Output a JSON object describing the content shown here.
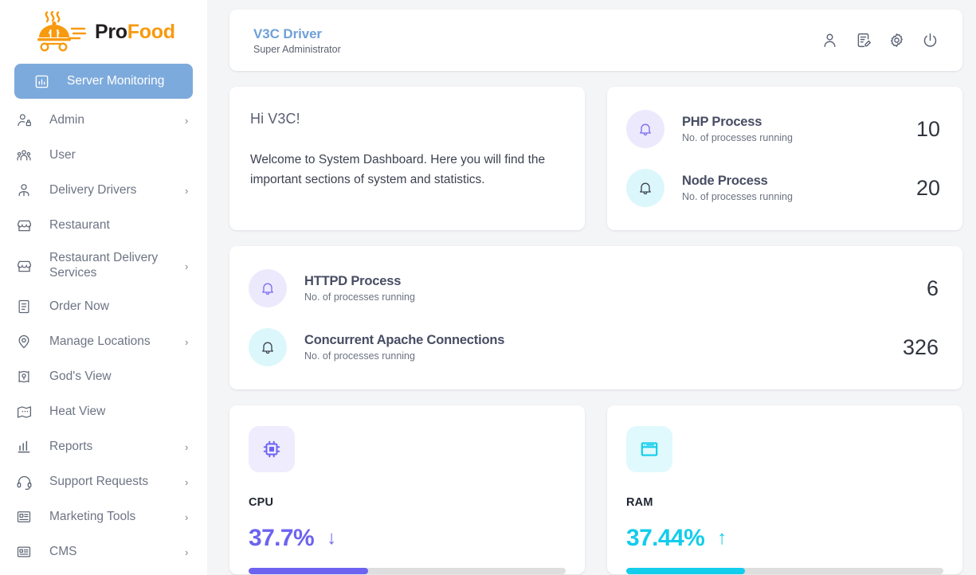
{
  "brand": {
    "name_pro": "Pro",
    "name_food": "Food",
    "logo_icon": "food-cart-cloche-icon"
  },
  "sidebar": {
    "items": [
      {
        "label": "Server Monitoring",
        "icon": "chart-bar-icon",
        "active": true,
        "chevron": false
      },
      {
        "label": "Admin",
        "icon": "user-lock-icon",
        "active": false,
        "chevron": true
      },
      {
        "label": "User",
        "icon": "users-group-icon",
        "active": false,
        "chevron": false
      },
      {
        "label": "Delivery Drivers",
        "icon": "user-tie-icon",
        "active": false,
        "chevron": true
      },
      {
        "label": "Restaurant",
        "icon": "storefront-icon",
        "active": false,
        "chevron": false
      },
      {
        "label": "Restaurant Delivery Services",
        "icon": "storefront-icon",
        "active": false,
        "chevron": true
      },
      {
        "label": "Order Now",
        "icon": "list-document-icon",
        "active": false,
        "chevron": false
      },
      {
        "label": "Manage Locations",
        "icon": "map-pin-icon",
        "active": false,
        "chevron": true
      },
      {
        "label": "God's View",
        "icon": "map-location-icon",
        "active": false,
        "chevron": false
      },
      {
        "label": "Heat View",
        "icon": "map-heat-icon",
        "active": false,
        "chevron": false
      },
      {
        "label": "Reports",
        "icon": "bar-chart-icon",
        "active": false,
        "chevron": true
      },
      {
        "label": "Support Requests",
        "icon": "headset-icon",
        "active": false,
        "chevron": true
      },
      {
        "label": "Marketing Tools",
        "icon": "id-card-icon",
        "active": false,
        "chevron": true
      },
      {
        "label": "CMS",
        "icon": "card-text-icon",
        "active": false,
        "chevron": true
      }
    ],
    "chevron_glyph": "›"
  },
  "header": {
    "user_name": "V3C Driver",
    "user_role": "Super Administrator",
    "actions": [
      {
        "icon": "user-profile-icon"
      },
      {
        "icon": "edit-document-icon"
      },
      {
        "icon": "gear-settings-icon"
      },
      {
        "icon": "power-logout-icon"
      }
    ]
  },
  "welcome": {
    "greeting": "Hi V3C!",
    "message": "Welcome to System Dashboard. Here you will find the important sections of system and statistics."
  },
  "processes_right": [
    {
      "title": "PHP Process",
      "subtitle": "No. of processes running",
      "value": "10",
      "icon": "bell-icon",
      "tone": "violet"
    },
    {
      "title": "Node Process",
      "subtitle": "No. of processes running",
      "value": "20",
      "icon": "bell-icon",
      "tone": "cyan"
    }
  ],
  "processes_wide": [
    {
      "title": "HTTPD Process",
      "subtitle": "No. of processes running",
      "value": "6",
      "icon": "bell-icon",
      "tone": "violet"
    },
    {
      "title": "Concurrent Apache Connections",
      "subtitle": "No. of processes running",
      "value": "326",
      "icon": "bell-icon",
      "tone": "cyan"
    }
  ],
  "metrics": [
    {
      "label": "CPU",
      "value": "37.7%",
      "trend": "down",
      "trend_glyph": "↓",
      "percent": 37.7,
      "icon": "cpu-chip-icon",
      "color": "#6c63f0"
    },
    {
      "label": "RAM",
      "value": "37.44%",
      "trend": "up",
      "trend_glyph": "↑",
      "percent": 37.44,
      "icon": "browser-window-icon",
      "color": "#12cdeb"
    }
  ],
  "colors": {
    "accent_violet": "#6c63f0",
    "accent_cyan": "#12cdeb",
    "sidebar_active": "#7daadc",
    "brand_orange": "#f79a0e",
    "page_bg": "#f4f5f7"
  }
}
